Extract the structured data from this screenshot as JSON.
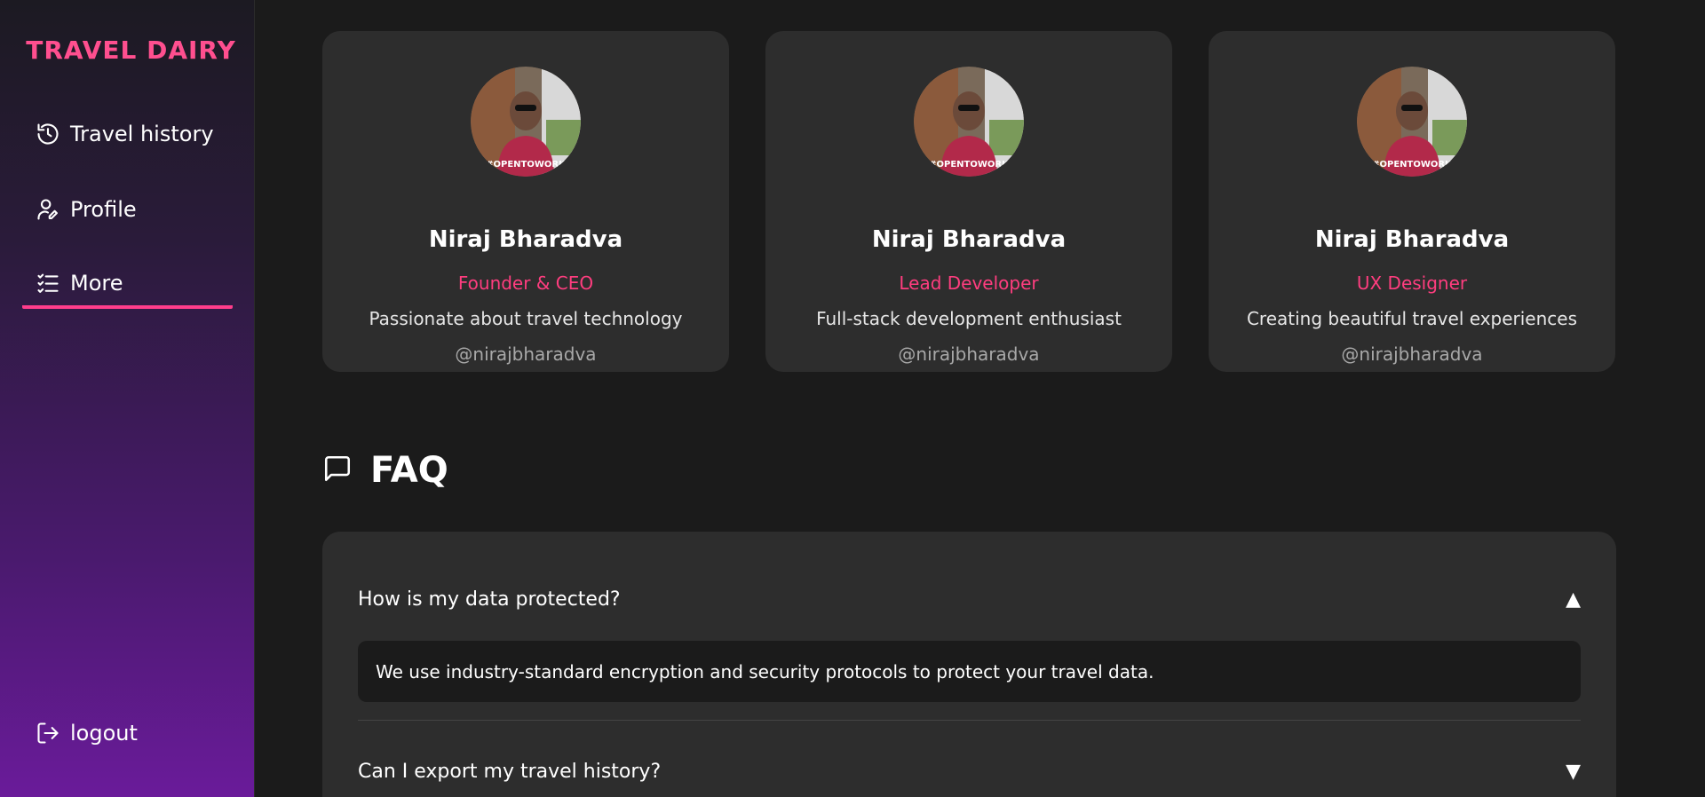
{
  "app": {
    "brand": "TRAVEL DAIRY"
  },
  "sidebar": {
    "items": [
      {
        "label": "Travel history",
        "icon": "history-icon"
      },
      {
        "label": "Profile",
        "icon": "user-edit-icon"
      },
      {
        "label": "More",
        "icon": "list-icon",
        "active": true
      }
    ],
    "logout": {
      "label": "logout",
      "icon": "logout-icon"
    }
  },
  "team": [
    {
      "name": "Niraj Bharadva",
      "role": "Founder & CEO",
      "bio": "Passionate about travel technology",
      "handle": "@nirajbharadva",
      "badge": "#OPENTOWORK"
    },
    {
      "name": "Niraj Bharadva",
      "role": "Lead Developer",
      "bio": "Full-stack development enthusiast",
      "handle": "@nirajbharadva",
      "badge": "#OPENTOWORK"
    },
    {
      "name": "Niraj Bharadva",
      "role": "UX Designer",
      "bio": "Creating beautiful travel experiences",
      "handle": "@nirajbharadva",
      "badge": "#OPENTOWORK"
    }
  ],
  "faq": {
    "title": "FAQ",
    "items": [
      {
        "question": "How is my data protected?",
        "answer": "We use industry-standard encryption and security protocols to protect your travel data.",
        "expanded": true,
        "chevron": "▲"
      },
      {
        "question": "Can I export my travel history?",
        "expanded": false,
        "chevron": "▼"
      }
    ]
  },
  "colors": {
    "accent": "#ff3d8b",
    "role": "#ff3d7f",
    "card_bg": "#2d2d2d",
    "page_bg": "#1b1b1b"
  }
}
